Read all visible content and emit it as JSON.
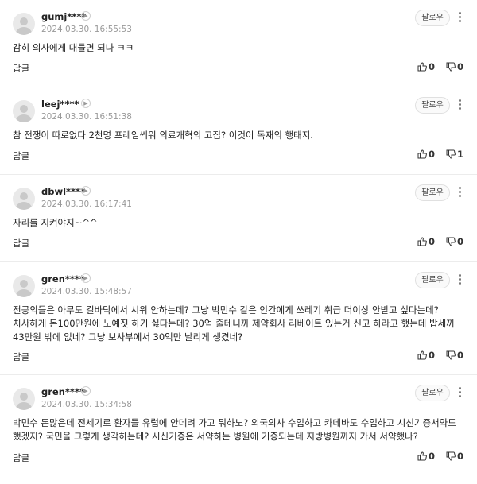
{
  "labels": {
    "follow": "팔로우",
    "reply": "답글"
  },
  "comments": [
    {
      "nick": "gumj****",
      "date": "2024.03.30. 16:55:53",
      "text": "감히 의사에게 대들면 되나 ㅋㅋ",
      "likes": "0",
      "dislikes": "0"
    },
    {
      "nick": "leej****",
      "date": "2024.03.30. 16:51:38",
      "text": "참 전쟁이 따로없다 2천명 프레임씌워 의료개혁의 고집? 이것이 독재의 행태지.",
      "likes": "0",
      "dislikes": "1"
    },
    {
      "nick": "dbwl****",
      "date": "2024.03.30. 16:17:41",
      "text": "자리를 지켜야지~^^",
      "likes": "0",
      "dislikes": "0"
    },
    {
      "nick": "gren****",
      "date": "2024.03.30. 15:48:57",
      "text": "전공의들은 아무도 길바닥에서 시위 안하는데? 그냥 박민수 같은 인간에게 쓰레기 취급 더이상 안받고 싶다는데? 치사하게 돈100만원에 노예짓 하기 싫다는데? 30억 줄테니까 제약회사 리베이트 있는거 신고 하라고 했는데 밥세끼 43만원 밖에 없네? 그냥 보사부에서 30억만 날리게 생겼네?",
      "likes": "0",
      "dislikes": "0"
    },
    {
      "nick": "gren****",
      "date": "2024.03.30. 15:34:58",
      "text": "박민수 돈많은데 전세기로 환자들 유럽에 안데려 가고 뭐하노? 외국의사 수입하고 카데바도 수입하고 시신기증서약도 했겠지? 국민을 그렇게 생각하는데? 시신기증은 서약하는 병원에 기증되는데 지방병원까지 가서 서약했나?",
      "likes": "0",
      "dislikes": "0"
    }
  ]
}
